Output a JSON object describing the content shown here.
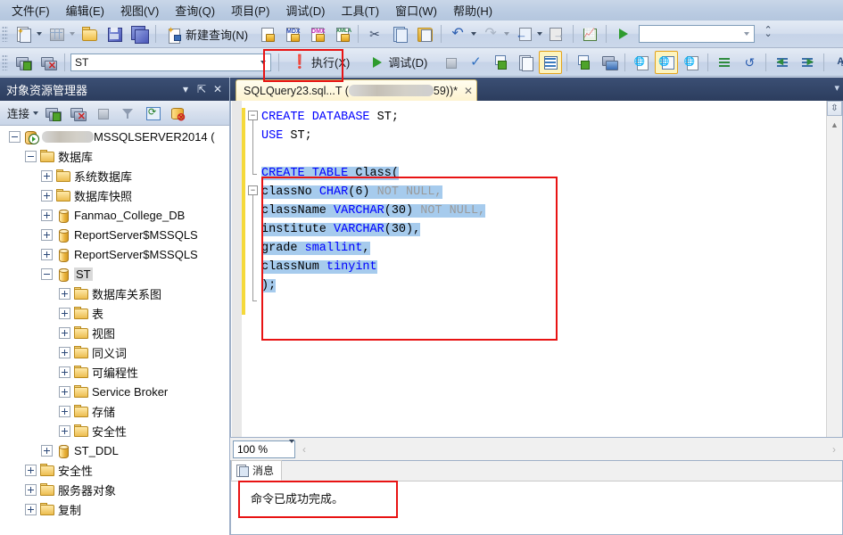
{
  "menu": {
    "items": [
      {
        "label": "文件(F)",
        "name": "menu-file"
      },
      {
        "label": "编辑(E)",
        "name": "menu-edit"
      },
      {
        "label": "视图(V)",
        "name": "menu-view"
      },
      {
        "label": "查询(Q)",
        "name": "menu-query"
      },
      {
        "label": "项目(P)",
        "name": "menu-project"
      },
      {
        "label": "调试(D)",
        "name": "menu-debug"
      },
      {
        "label": "工具(T)",
        "name": "menu-tools"
      },
      {
        "label": "窗口(W)",
        "name": "menu-window"
      },
      {
        "label": "帮助(H)",
        "name": "menu-help"
      }
    ]
  },
  "toolbar_main": {
    "new_query_label": "新建查询(N)",
    "icons": [
      "new-project-icon",
      "new-table-icon",
      "open-file-icon",
      "save-icon",
      "save-all-icon",
      "new-query-icon",
      "new-db-engine-query-icon",
      "new-analysis-services-mdx-query-icon",
      "new-analysis-services-dmx-query-icon",
      "new-analysis-services-xmla-query-icon",
      "cut-icon",
      "copy-icon",
      "paste-icon",
      "undo-icon",
      "redo-icon",
      "navigate-backward-icon",
      "navigate-forward-icon",
      "activity-monitor-icon",
      "run-icon"
    ]
  },
  "toolbar_query": {
    "execute_label": "执行(X)",
    "debug_label": "调试(D)",
    "database_value": "ST",
    "database_placeholder": "",
    "second_combo_value": "",
    "icons": [
      "connect-icon",
      "disconnect-icon",
      "execute-icon",
      "debug-icon",
      "stop-icon",
      "parse-icon",
      "display-estimated-execution-plan-icon",
      "query-options-icon",
      "include-actual-execution-plan-icon",
      "include-client-statistics-icon",
      "results-to-text-icon",
      "results-to-grid-icon",
      "results-to-file-icon",
      "comment-icon",
      "uncomment-icon",
      "decrease-indent-icon",
      "increase-indent-icon",
      "specify-values-for-template-parameters-icon"
    ]
  },
  "object_explorer": {
    "title": "对象资源管理器",
    "connect_label": "连接",
    "toolbar_icons": [
      "connect-icon",
      "disconnect-icon",
      "stop-icon",
      "filter-icon",
      "refresh-icon",
      "sync-icon"
    ],
    "titlebar_buttons": [
      "chevron-down-icon",
      "pin-icon",
      "close-icon"
    ],
    "tree": [
      {
        "label": "MSSQLSERVER2014",
        "redacted_prefix": true,
        "suffix": " (",
        "indent": 0,
        "state": "minus",
        "icon": "server-icon"
      },
      {
        "label": "数据库",
        "indent": 1,
        "state": "minus",
        "icon": "folder-icon"
      },
      {
        "label": "系统数据库",
        "indent": 2,
        "state": "plus",
        "icon": "folder-icon"
      },
      {
        "label": "数据库快照",
        "indent": 2,
        "state": "plus",
        "icon": "folder-icon"
      },
      {
        "label": "Fanmao_College_DB",
        "indent": 2,
        "state": "plus",
        "icon": "database-icon"
      },
      {
        "label": "ReportServer$MSSQLS",
        "indent": 2,
        "state": "plus",
        "icon": "database-icon"
      },
      {
        "label": "ReportServer$MSSQLS",
        "indent": 2,
        "state": "plus",
        "icon": "database-icon"
      },
      {
        "label": "ST",
        "indent": 2,
        "state": "minus",
        "icon": "database-icon",
        "selected": true
      },
      {
        "label": "数据库关系图",
        "indent": 3,
        "state": "plus",
        "icon": "folder-icon"
      },
      {
        "label": "表",
        "indent": 3,
        "state": "plus",
        "icon": "folder-icon"
      },
      {
        "label": "视图",
        "indent": 3,
        "state": "plus",
        "icon": "folder-icon"
      },
      {
        "label": "同义词",
        "indent": 3,
        "state": "plus",
        "icon": "folder-icon"
      },
      {
        "label": "可编程性",
        "indent": 3,
        "state": "plus",
        "icon": "folder-icon"
      },
      {
        "label": "Service Broker",
        "indent": 3,
        "state": "plus",
        "icon": "folder-icon"
      },
      {
        "label": "存储",
        "indent": 3,
        "state": "plus",
        "icon": "folder-icon"
      },
      {
        "label": "安全性",
        "indent": 3,
        "state": "plus",
        "icon": "folder-icon"
      },
      {
        "label": "ST_DDL",
        "indent": 2,
        "state": "plus",
        "icon": "database-icon"
      },
      {
        "label": "安全性",
        "indent": 1,
        "state": "plus",
        "icon": "folder-icon"
      },
      {
        "label": "服务器对象",
        "indent": 1,
        "state": "plus",
        "icon": "folder-icon"
      },
      {
        "label": "复制",
        "indent": 1,
        "state": "plus",
        "icon": "folder-icon"
      }
    ]
  },
  "tab": {
    "prefix": "SQLQuery23.sql...T (",
    "suffix": "59))*",
    "redacted": true,
    "close_label": "✕"
  },
  "editor": {
    "lines": [
      "CREATE DATABASE ST;",
      "USE ST;",
      "",
      "CREATE TABLE Class(",
      "classNo CHAR(6) NOT NULL,",
      "className VARCHAR(30) NOT NULL,",
      "institute VARCHAR(30),",
      "grade smallint,",
      "classNum tinyint",
      ");"
    ],
    "zoom_level": "100 %"
  },
  "results": {
    "tab_label": "消息",
    "message": "命令已成功完成。"
  },
  "annotations": {
    "execute_button_highlight": true,
    "create_table_highlight": true,
    "message_highlight": true,
    "color": "#e81313"
  }
}
